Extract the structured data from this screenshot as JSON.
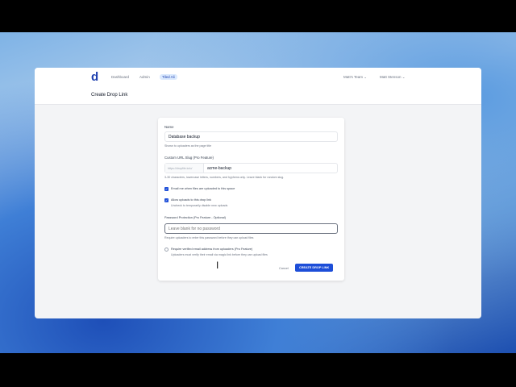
{
  "nav": {
    "logo": "d",
    "items": [
      "Dashboard",
      "Admin",
      "Tiled Ali"
    ],
    "team": "Matt's Team",
    "user": "Matt Stenson"
  },
  "page_title": "Create Drop Link",
  "form": {
    "name_label": "Name",
    "name_value": "Database backup",
    "name_help": "Shown to uploaders as the page title",
    "slug_label": "Custom URL Slug (Pro Feature)",
    "slug_prefix": "https://dropfile.io/u/",
    "slug_value": "acme-backup",
    "slug_help": "3-30 characters, lowercase letters, numbers, and hyphens only. Leave blank for random slug.",
    "email_notify_label": "Email me when files are uploaded to this space",
    "email_notify_checked": true,
    "allow_uploads_label": "Allow uploads to this drop link",
    "allow_uploads_checked": true,
    "allow_uploads_help": "Uncheck to temporarily disable new uploads",
    "password_label": "Password Protection (Pro Feature - Optional)",
    "password_placeholder": "Leave blank for no password",
    "password_help": "Require uploaders to enter this password before they can upload files",
    "verify_label": "Require verified email address from uploaders (Pro Feature)",
    "verify_checked": false,
    "verify_help": "Uploaders must verify their email via magic link before they can upload files",
    "cancel": "Cancel",
    "submit": "CREATE DROP LINK"
  }
}
